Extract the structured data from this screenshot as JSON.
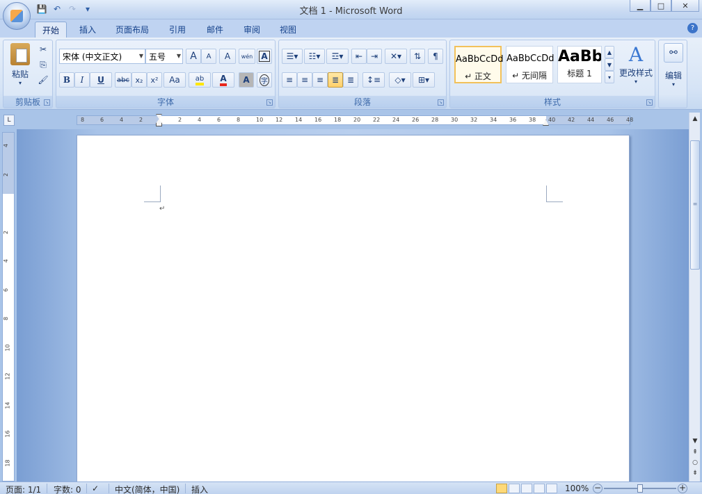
{
  "window": {
    "title": "文档 1 - Microsoft Word",
    "min": "▁",
    "max": "□",
    "close": "✕"
  },
  "qat": {
    "save": "💾",
    "undo": "↶",
    "redo": "↷",
    "more": "▾"
  },
  "tabs": [
    "开始",
    "插入",
    "页面布局",
    "引用",
    "邮件",
    "审阅",
    "视图"
  ],
  "help": "?",
  "clipboard": {
    "label": "剪贴板",
    "paste": "粘贴"
  },
  "font": {
    "label": "字体",
    "name": "宋体 (中文正文)",
    "size": "五号",
    "bold": "B",
    "italic": "I",
    "underline": "U",
    "strike": "abc",
    "sub": "x₂",
    "sup": "x²",
    "case": "Aa",
    "grow": "A",
    "shrink": "A",
    "clear": "A",
    "phonetic": "wén",
    "border": "A",
    "shade": "A",
    "enclose": "字"
  },
  "paragraph": {
    "label": "段落"
  },
  "styles": {
    "label": "样式",
    "items": [
      {
        "preview": "AaBbCcDd",
        "name": "↵ 正文"
      },
      {
        "preview": "AaBbCcDd",
        "name": "↵ 无间隔"
      },
      {
        "preview": "AaBb",
        "name": "标题 1"
      }
    ],
    "change": "更改样式"
  },
  "editing": {
    "label": "编辑"
  },
  "ruler": {
    "h_ticks": [
      "8",
      "6",
      "4",
      "2",
      "",
      "2",
      "4",
      "6",
      "8",
      "10",
      "12",
      "14",
      "16",
      "18",
      "20",
      "22",
      "24",
      "26",
      "28",
      "30",
      "32",
      "34",
      "36",
      "38",
      "40",
      "42",
      "44",
      "46",
      "48"
    ],
    "v_ticks": [
      "4",
      "2",
      "",
      "2",
      "4",
      "6",
      "8",
      "10",
      "12",
      "14",
      "16",
      "18"
    ]
  },
  "document": {
    "paragraph_mark": "↵"
  },
  "status": {
    "page": "页面: 1/1",
    "words": "字数: 0",
    "lang": "中文(简体，中国)",
    "mode": "插入",
    "zoom": "100%"
  }
}
